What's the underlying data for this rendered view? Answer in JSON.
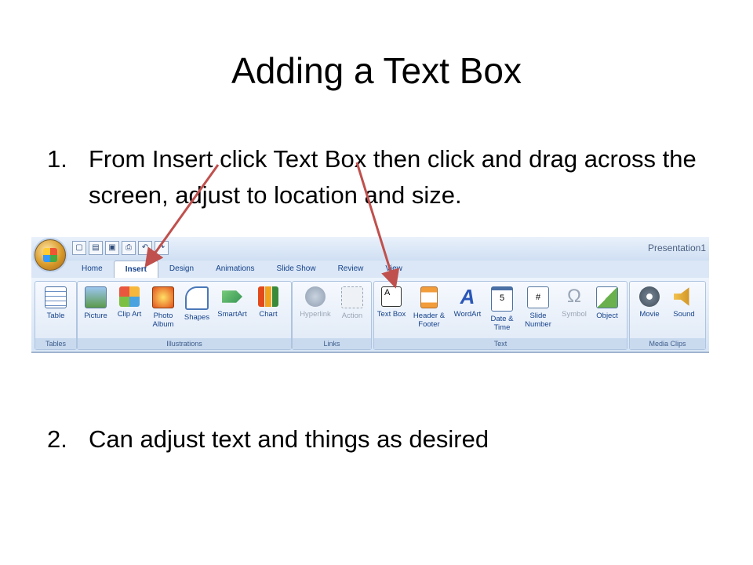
{
  "slide": {
    "title": "Adding a Text Box",
    "steps": [
      {
        "num": "1.",
        "text": "From Insert click Text Box then click and drag across the screen, adjust to location and size."
      },
      {
        "num": "2.",
        "text": "Can adjust text and things as desired"
      }
    ]
  },
  "ribbon": {
    "doc_title": "Presentation1",
    "tabs": [
      "Home",
      "Insert",
      "Design",
      "Animations",
      "Slide Show",
      "Review",
      "View"
    ],
    "active_tab": "Insert",
    "groups": {
      "tables": {
        "label": "Tables",
        "buttons": [
          "Table"
        ]
      },
      "illustrations": {
        "label": "Illustrations",
        "buttons": [
          "Picture",
          "Clip Art",
          "Photo Album",
          "Shapes",
          "SmartArt",
          "Chart"
        ]
      },
      "links": {
        "label": "Links",
        "buttons": [
          "Hyperlink",
          "Action"
        ]
      },
      "text": {
        "label": "Text",
        "buttons": [
          "Text Box",
          "Header & Footer",
          "WordArt",
          "Date & Time",
          "Slide Number",
          "Symbol",
          "Object"
        ]
      },
      "media": {
        "label": "Media Clips",
        "buttons": [
          "Movie",
          "Sound"
        ]
      }
    }
  },
  "colors": {
    "arrow": "#c0504d",
    "ribbon_text": "#15428b"
  }
}
